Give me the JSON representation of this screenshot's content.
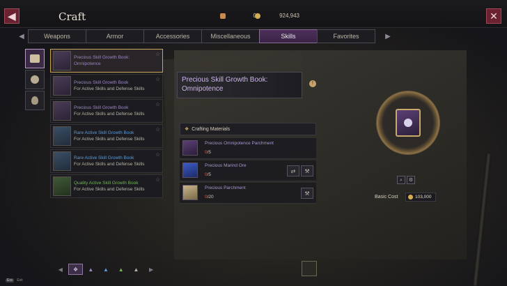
{
  "header": {
    "title": "Craft",
    "back_icon": "back-arrow-icon",
    "close_icon": "close-icon",
    "currency_primary": "0",
    "currency_secondary": "924,943"
  },
  "tabs": [
    {
      "label": "Weapons"
    },
    {
      "label": "Armor"
    },
    {
      "label": "Accessories"
    },
    {
      "label": "Miscellaneous"
    },
    {
      "label": "Skills",
      "active": true
    },
    {
      "label": "Favorites"
    }
  ],
  "recipes": [
    {
      "name": "Precious Skill Growth Book:",
      "sub": "Omnipotence",
      "grade": "precious",
      "selected": true
    },
    {
      "name": "Precious Skill Growth Book",
      "sub": "For Active Skills and Defense Skills",
      "grade": "precious"
    },
    {
      "name": "Precious Skill Growth Book",
      "sub": "For Active Skills and Defense Skills",
      "grade": "precious"
    },
    {
      "name": "Rare Active Skill Growth Book",
      "sub": "For Active Skills and Defense Skills",
      "grade": "rare"
    },
    {
      "name": "Rare Active Skill Growth Book",
      "sub": "For Active Skills and Defense Skills",
      "grade": "rare"
    },
    {
      "name": "Quality Active Skill Growth Book",
      "sub": "For Active Skills and Defense Skills",
      "grade": "quality"
    }
  ],
  "detail": {
    "title_line1": "Precious Skill Growth Book:",
    "title_line2": "Omnipotence",
    "materials_header": "Crafting Materials",
    "materials": [
      {
        "name": "Precious Omnipotence Parchment",
        "have": "0",
        "need": "/5"
      },
      {
        "name": "Precious Marind Ore",
        "have": "0",
        "need": "/5"
      },
      {
        "name": "Precious Parchment",
        "have": "0",
        "need": "/20"
      }
    ],
    "basic_cost_label": "Basic Cost",
    "basic_cost_value": "103,000"
  },
  "hint": {
    "key": "Esc",
    "label": "Exit"
  },
  "colors": {
    "accent_purple": "#3a2446",
    "gold": "#c9a86c",
    "rare_blue": "#5f9ad6",
    "quality_green": "#73b257",
    "precious_purple": "#9b86c4",
    "missing_red": "#d46060"
  }
}
